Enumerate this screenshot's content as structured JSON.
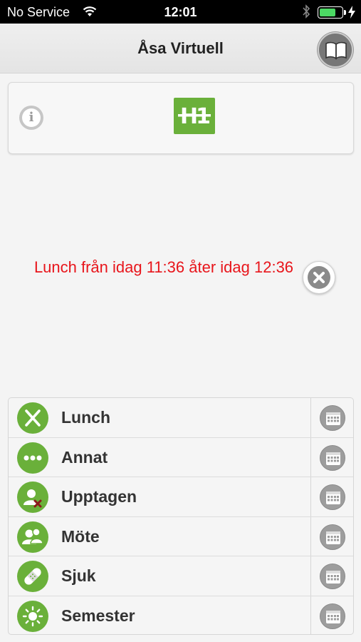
{
  "status_bar": {
    "carrier": "No Service",
    "time": "12:01"
  },
  "nav": {
    "title": "Åsa Virtuell",
    "book_icon": "book-icon"
  },
  "card": {
    "info_icon": "info-icon",
    "logo_text": "H1"
  },
  "current_status": {
    "message": "Lunch från idag 11:36 åter idag 12:36"
  },
  "statuses": [
    {
      "label": "Lunch",
      "icon": "fork-knife-icon"
    },
    {
      "label": "Annat",
      "icon": "dots-icon"
    },
    {
      "label": "Upptagen",
      "icon": "busy-person-icon"
    },
    {
      "label": "Möte",
      "icon": "meeting-icon"
    },
    {
      "label": "Sjuk",
      "icon": "bandage-icon"
    },
    {
      "label": "Semester",
      "icon": "sun-icon"
    }
  ],
  "colors": {
    "accent_green": "#6ab03a",
    "status_red": "#e8151b",
    "battery_green": "#4cd964"
  },
  "battery_level": 0.75
}
